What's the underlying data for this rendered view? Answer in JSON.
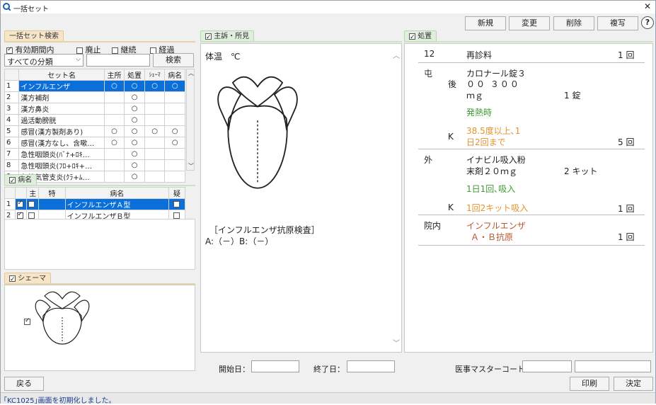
{
  "window": {
    "title": "一括セット"
  },
  "toolbar": {
    "new": "新規",
    "change": "変更",
    "delete": "削除",
    "copy": "複写",
    "help": "?"
  },
  "set_search": {
    "tab": "一括セット検索",
    "chk_valid": "有効期間内",
    "chk_abolish": "廃止",
    "chk_continue": "継続",
    "chk_elapsed": "経過",
    "category": "すべての分類",
    "search_button": "検索",
    "columns": [
      "",
      "セット名",
      "主所",
      "処置",
      "ｼｪｰﾏ",
      "病名"
    ],
    "rows": [
      {
        "no": "1",
        "name": "インフルエンザ",
        "c1": "○",
        "c2": "○",
        "c3": "○",
        "c4": "○"
      },
      {
        "no": "2",
        "name": "漢方補剤",
        "c1": "",
        "c2": "○",
        "c3": "",
        "c4": ""
      },
      {
        "no": "3",
        "name": "漢方鼻炎",
        "c1": "",
        "c2": "○",
        "c3": "",
        "c4": ""
      },
      {
        "no": "4",
        "name": "過活動膀胱",
        "c1": "",
        "c2": "○",
        "c3": "",
        "c4": ""
      },
      {
        "no": "5",
        "name": "感冒(漢方製剤あり)",
        "c1": "○",
        "c2": "○",
        "c3": "○",
        "c4": "○"
      },
      {
        "no": "6",
        "name": "感冒(漢方なし、含嗽…",
        "c1": "○",
        "c2": "○",
        "c3": "",
        "c4": "○"
      },
      {
        "no": "7",
        "name": "急性咽頭炎(ﾊﾞﾅ+ﾛｷ…",
        "c1": "",
        "c2": "○",
        "c3": "",
        "c4": ""
      },
      {
        "no": "8",
        "name": "急性咽頭炎(ﾌﾛ+ﾛｷ+…",
        "c1": "",
        "c2": "○",
        "c3": "",
        "c4": ""
      },
      {
        "no": "9",
        "name": "急性気管支炎(ｸﾗ+ﾑ…",
        "c1": "",
        "c2": "○",
        "c3": "",
        "c4": ""
      }
    ]
  },
  "disease": {
    "tab": "病名",
    "columns": [
      "",
      "",
      "主",
      "特",
      "病名",
      "疑"
    ],
    "rows": [
      {
        "no": "1",
        "name": "インフルエンザＡ型"
      },
      {
        "no": "2",
        "name": "インフルエンザＢ型"
      }
    ]
  },
  "schema": {
    "tab": "シェーマ"
  },
  "complaint": {
    "tab": "主訴・所見",
    "temp": "体温　℃",
    "exam": "［インフルエンザ抗原検査］",
    "result": "A:（－）B:（－）"
  },
  "prescription": {
    "tab": "処置",
    "rows": [
      {
        "code": "12",
        "name": "再診料",
        "count": "1 回"
      },
      {
        "code": "屯",
        "sub": "後",
        "name": "カロナール錠３",
        "name2": "００ ３００",
        "unit": "ｍｇ",
        "qty": "1 錠",
        "note": "発熱時",
        "k": "K",
        "kn1": "38.5度以上､1",
        "kn2": "日2回まで",
        "count": "5 回"
      },
      {
        "code": "外",
        "name": "イナビル吸入粉",
        "name2": "末剤２０ｍｇ",
        "qty": "2 キット",
        "note": "1日1回､吸入",
        "k": "K",
        "kn1": "1回2キット吸入",
        "count": "1 回"
      },
      {
        "code": "院内",
        "name": "インフルエンザ",
        "name2": "Ａ・Ｂ抗原",
        "count": "1 回"
      }
    ]
  },
  "dates": {
    "start": "開始日：",
    "end": "終了日：",
    "master": "医事マスターコード："
  },
  "footer": {
    "back": "戻る",
    "print": "印刷",
    "decide": "決定",
    "status": "｢KC1025｣画面を初期化しました。"
  }
}
